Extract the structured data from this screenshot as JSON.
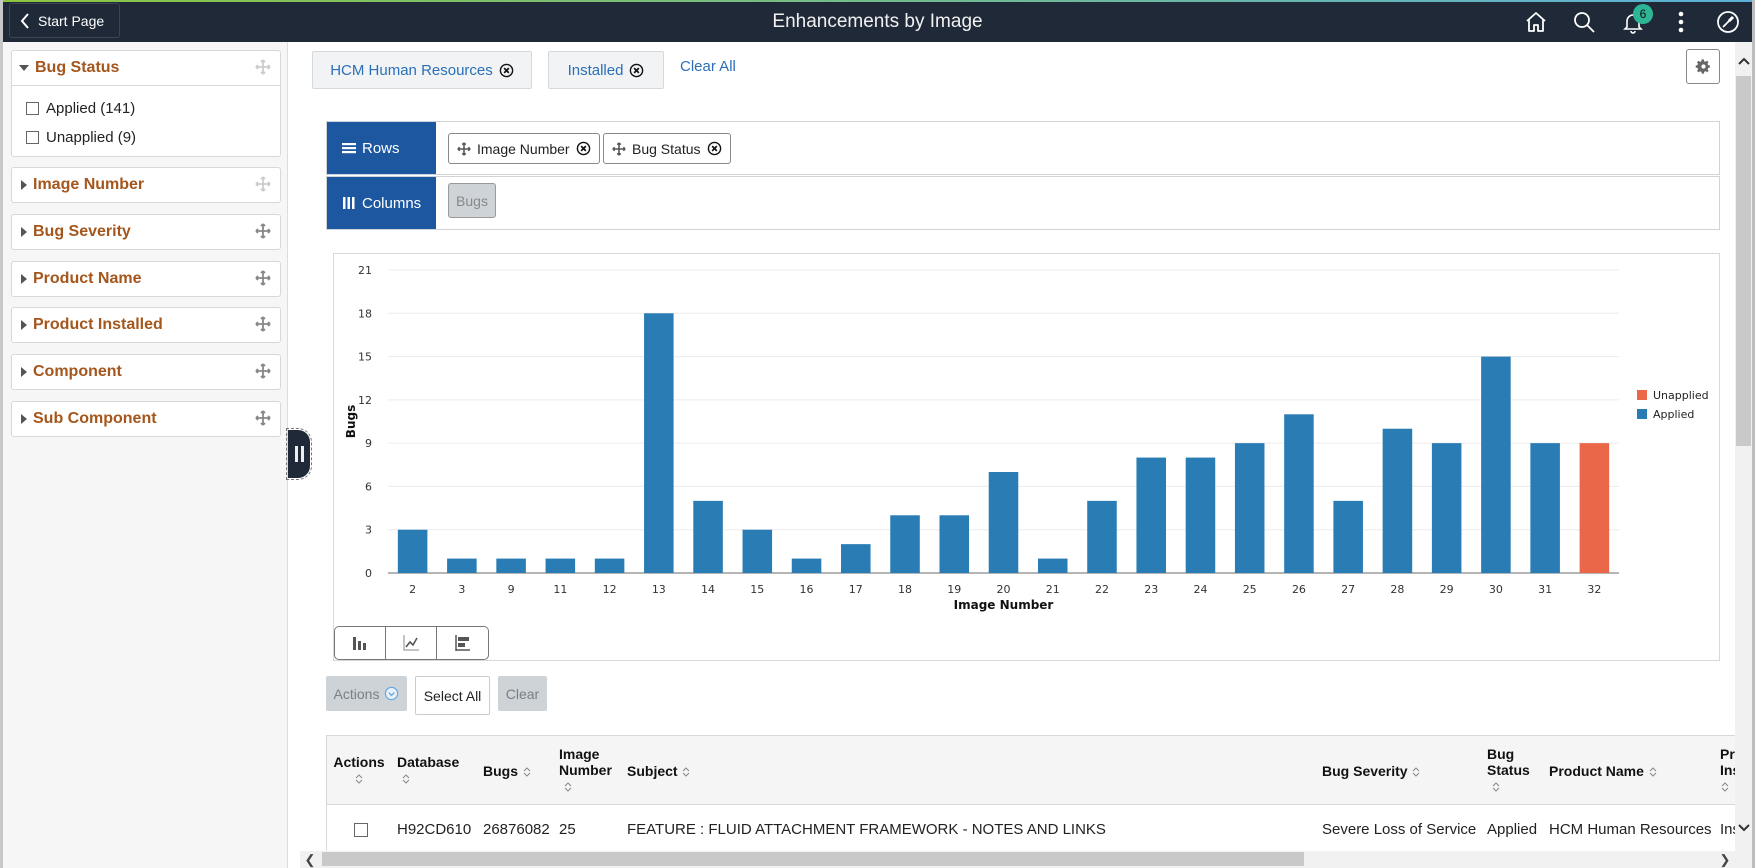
{
  "header": {
    "back_label": "Start Page",
    "title": "Enhancements by Image",
    "notification_count": "6",
    "icons": [
      "home-icon",
      "search-icon",
      "bell-icon",
      "more-vertical-icon",
      "compass-icon"
    ]
  },
  "facets": [
    {
      "title": "Bug Status",
      "expanded": true,
      "options": [
        {
          "label": "Applied (141)",
          "checked": false
        },
        {
          "label": "Unapplied (9)",
          "checked": false
        }
      ]
    },
    {
      "title": "Image Number",
      "expanded": false
    },
    {
      "title": "Bug Severity",
      "expanded": false
    },
    {
      "title": "Product Name",
      "expanded": false
    },
    {
      "title": "Product Installed",
      "expanded": false
    },
    {
      "title": "Component",
      "expanded": false
    },
    {
      "title": "Sub Component",
      "expanded": false
    }
  ],
  "filters": {
    "chips": [
      "HCM Human Resources",
      "Installed"
    ],
    "clear_all": "Clear All"
  },
  "pivot": {
    "rows_label": "Rows",
    "rows_items": [
      "Image Number",
      "Bug Status"
    ],
    "columns_label": "Columns",
    "columns_items": [
      "Bugs"
    ]
  },
  "colors": {
    "applied": "#2a7db4",
    "unapplied": "#ea6749",
    "brand_blue": "#1d57a0",
    "facet_title": "#a4561c",
    "link": "#2a6fb8"
  },
  "chart_data": {
    "type": "bar",
    "title": "",
    "xlabel": "Image Number",
    "ylabel": "Bugs",
    "ylim": [
      0,
      21
    ],
    "yticks": [
      0,
      3,
      6,
      9,
      12,
      15,
      18,
      21
    ],
    "grid": true,
    "legend_position": "right",
    "categories": [
      "2",
      "3",
      "9",
      "11",
      "12",
      "13",
      "14",
      "15",
      "16",
      "17",
      "18",
      "19",
      "20",
      "21",
      "22",
      "23",
      "24",
      "25",
      "26",
      "27",
      "28",
      "29",
      "30",
      "31",
      "32"
    ],
    "series": [
      {
        "name": "Unapplied",
        "color": "#ea6749",
        "values": [
          0,
          0,
          0,
          0,
          0,
          0,
          0,
          0,
          0,
          0,
          0,
          0,
          0,
          0,
          0,
          0,
          0,
          0,
          0,
          0,
          0,
          0,
          0,
          0,
          9
        ]
      },
      {
        "name": "Applied",
        "color": "#2a7db4",
        "values": [
          3,
          1,
          1,
          1,
          1,
          18,
          5,
          3,
          1,
          2,
          4,
          4,
          7,
          1,
          5,
          8,
          8,
          9,
          11,
          5,
          10,
          9,
          15,
          9,
          0
        ]
      }
    ]
  },
  "chart_types": [
    "bar-chart-icon",
    "line-chart-icon",
    "horizontal-bar-chart-icon"
  ],
  "actions": {
    "actions_label": "Actions",
    "select_all_label": "Select All",
    "clear_label": "Clear"
  },
  "table": {
    "columns": [
      {
        "label": "Actions",
        "label2": ""
      },
      {
        "label": "Database",
        "label2": ""
      },
      {
        "label": "Bugs",
        "label2": ""
      },
      {
        "label": "Image",
        "label2": "Number"
      },
      {
        "label": "Subject",
        "label2": ""
      },
      {
        "label": "Bug Severity",
        "label2": ""
      },
      {
        "label": "Bug",
        "label2": "Status"
      },
      {
        "label": "Product Name",
        "label2": ""
      },
      {
        "label": "Pr",
        "label2": "Ins"
      }
    ],
    "rows": [
      {
        "database": "H92CD610",
        "bugs": "26876082",
        "image_number": "25",
        "subject": "FEATURE : FLUID ATTACHMENT FRAMEWORK - NOTES AND LINKS",
        "bug_severity": "Severe Loss of Service",
        "bug_status": "Applied",
        "product_name": "HCM Human Resources",
        "product_installed": "Ins"
      }
    ]
  }
}
